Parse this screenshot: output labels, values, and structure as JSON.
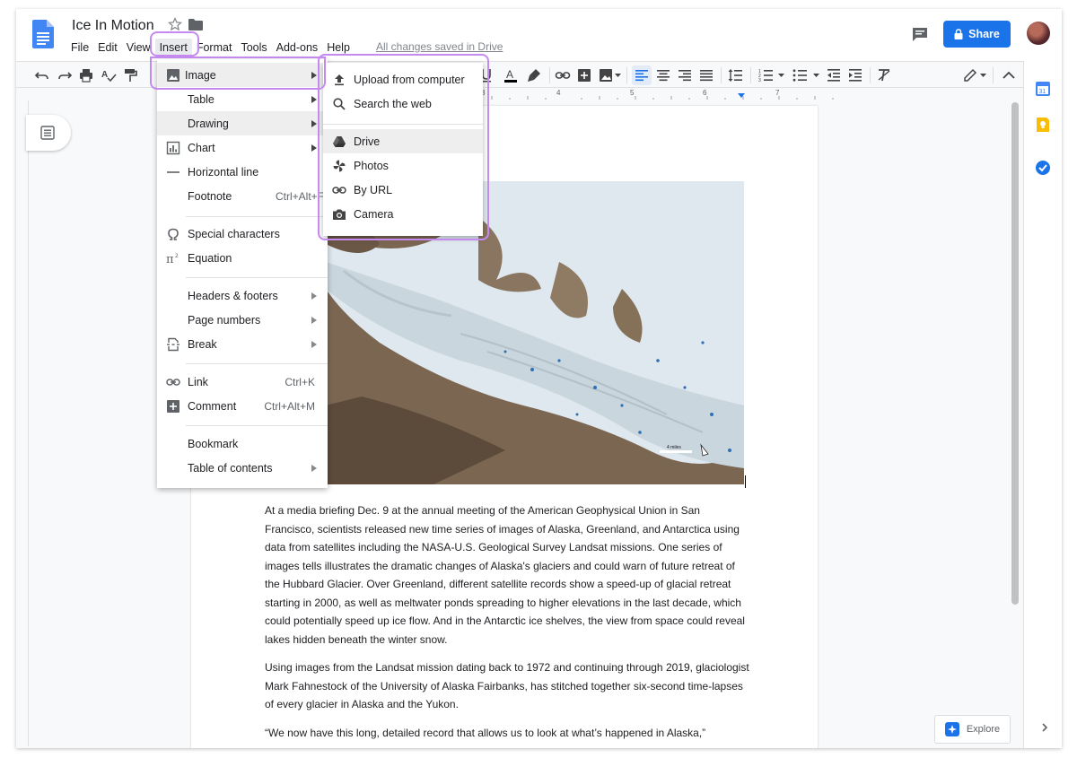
{
  "doc": {
    "title": "Ice In Motion",
    "status": "All changes saved in Drive"
  },
  "menubar": [
    "File",
    "Edit",
    "View",
    "Insert",
    "Format",
    "Tools",
    "Add-ons",
    "Help"
  ],
  "header": {
    "share_label": "Share"
  },
  "toolbar": {
    "icons": [
      "undo-icon",
      "redo-icon",
      "print-icon",
      "spellcheck-icon",
      "paint-format-icon",
      "underline-icon",
      "text-color-icon",
      "highlight-icon",
      "link-icon",
      "add-comment-icon",
      "insert-image-icon",
      "align-left-icon",
      "align-center-icon",
      "align-right-icon",
      "justify-icon",
      "line-spacing-icon",
      "numbered-list-icon",
      "bulleted-list-icon",
      "decrease-indent-icon",
      "increase-indent-icon",
      "clear-formatting-icon",
      "editing-mode-icon",
      "collapse-icon"
    ]
  },
  "ruler": {
    "numbers": [
      "3",
      "4",
      "5",
      "6",
      "7"
    ]
  },
  "insert_menu": {
    "items": [
      {
        "label": "Image",
        "icon": "image-icon",
        "submenu": true
      },
      {
        "label": "Table",
        "icon": "",
        "submenu": true
      },
      {
        "label": "Drawing",
        "icon": "",
        "submenu": true
      },
      {
        "label": "Chart",
        "icon": "chart-icon",
        "submenu": true
      },
      {
        "label": "Horizontal line",
        "icon": "horizontal-line-icon",
        "submenu": false
      },
      {
        "label": "Footnote",
        "shortcut": "Ctrl+Alt+F"
      },
      {
        "label": "Special characters",
        "icon": "omega-icon"
      },
      {
        "label": "Equation",
        "icon": "pi-icon"
      },
      {
        "label": "Headers & footers",
        "submenu": true
      },
      {
        "label": "Page numbers",
        "submenu": true
      },
      {
        "label": "Break",
        "icon": "page-break-icon",
        "submenu": true
      },
      {
        "label": "Link",
        "icon": "link-icon",
        "shortcut": "Ctrl+K"
      },
      {
        "label": "Comment",
        "icon": "comment-plus-icon",
        "shortcut": "Ctrl+Alt+M"
      },
      {
        "label": "Bookmark"
      },
      {
        "label": "Table of contents",
        "submenu": true
      }
    ]
  },
  "image_submenu": {
    "items": [
      {
        "label": "Upload from computer",
        "icon": "upload-icon"
      },
      {
        "label": "Search the web",
        "icon": "search-icon"
      },
      {
        "label": "Drive",
        "icon": "drive-icon"
      },
      {
        "label": "Photos",
        "icon": "photos-icon"
      },
      {
        "label": "By URL",
        "icon": "link-icon"
      },
      {
        "label": "Camera",
        "icon": "camera-icon"
      }
    ]
  },
  "figure": {
    "scale_label": "4 miles"
  },
  "body": {
    "paragraphs": [
      "At a media briefing Dec. 9 at the annual meeting of the American Geophysical Union in San Francisco, scientists released new time series of images of Alaska, Greenland, and Antarctica using data from satellites including the NASA-U.S. Geological Survey Landsat missions. One series of images tells illustrates the dramatic changes of Alaska's glaciers and could warn of future retreat of the Hubbard Glacier. Over Greenland, different satellite records show a speed-up of glacial retreat starting in 2000, as well as meltwater ponds spreading to higher elevations in the last decade, which could potentially speed up ice flow. And in the Antarctic ice shelves, the view from space could reveal lakes hidden beneath the winter snow.",
      "Using images from the Landsat mission dating back to 1972 and continuing through 2019, glaciologist Mark Fahnestock of the University of Alaska Fairbanks, has stitched together six-second time-lapses of every glacier in Alaska and the Yukon.",
      "“We now have this long, detailed record that allows us to look at what’s happened in Alaska,”"
    ]
  },
  "explore": {
    "label": "Explore"
  },
  "colors": {
    "accent": "#1a73e8",
    "highlight_outline": "#c58af0"
  }
}
